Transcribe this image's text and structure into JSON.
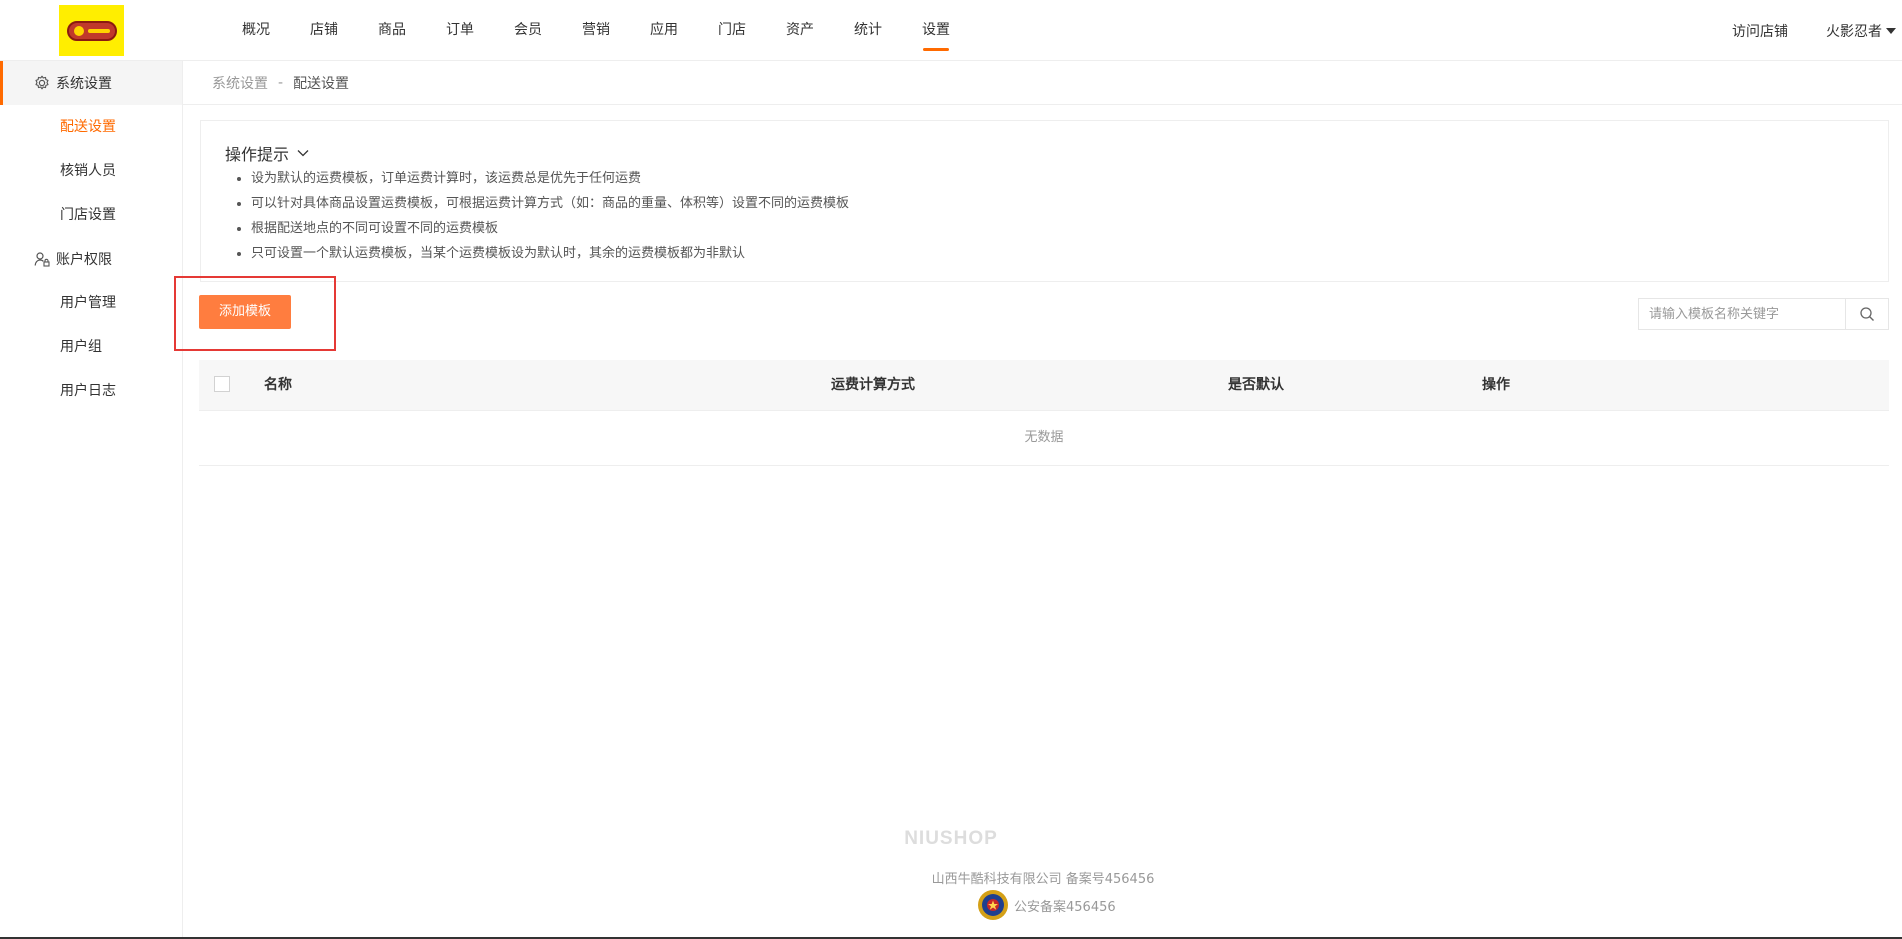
{
  "header": {
    "nav": [
      "概况",
      "店铺",
      "商品",
      "订单",
      "会员",
      "营销",
      "应用",
      "门店",
      "资产",
      "统计",
      "设置"
    ],
    "active_nav": "设置",
    "visit_store": "访问店铺",
    "user_name": "火影忍者"
  },
  "sidebar": {
    "groups": [
      {
        "label": "系统设置",
        "icon": "gear-icon",
        "items": [
          "配送设置",
          "核销人员",
          "门店设置"
        ]
      },
      {
        "label": "账户权限",
        "icon": "user-lock-icon",
        "items": [
          "用户管理",
          "用户组",
          "用户日志"
        ]
      }
    ],
    "active_item": "配送设置"
  },
  "breadcrumb": {
    "parent": "系统设置",
    "separator": "-",
    "current": "配送设置"
  },
  "tips": {
    "title": "操作提示",
    "items": [
      "设为默认的运费模板，订单运费计算时，该运费总是优先于任何运费",
      "可以针对具体商品设置运费模板，可根据运费计算方式（如：商品的重量、体积等）设置不同的运费模板",
      "根据配送地点的不同可设置不同的运费模板",
      "只可设置一个默认运费模板，当某个运费模板设为默认时，其余的运费模板都为非默认"
    ]
  },
  "toolbar": {
    "add_label": "添加模板",
    "search_placeholder": "请输入模板名称关键字"
  },
  "table": {
    "columns": [
      "名称",
      "运费计算方式",
      "是否默认",
      "操作"
    ],
    "empty_text": "无数据"
  },
  "footer": {
    "brand": "NIUSHOP",
    "company": "山西牛酷科技有限公司  备案号456456",
    "police": "公安备案456456"
  },
  "colors": {
    "accent": "#ff6a00",
    "button": "#ff7d3f",
    "highlight": "#e53935",
    "logo_bg": "#ffee00"
  }
}
